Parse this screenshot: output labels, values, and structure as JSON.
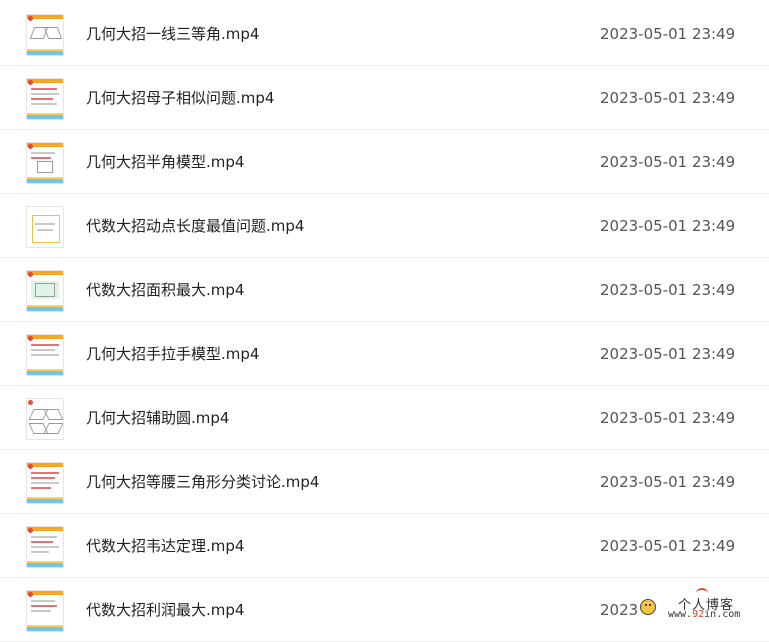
{
  "files": [
    {
      "name": "几何大招一线三等角.mp4",
      "date": "2023-05-01 23:49"
    },
    {
      "name": "几何大招母子相似问题.mp4",
      "date": "2023-05-01 23:49"
    },
    {
      "name": "几何大招半角模型.mp4",
      "date": "2023-05-01 23:49"
    },
    {
      "name": "代数大招动点长度最值问题.mp4",
      "date": "2023-05-01 23:49"
    },
    {
      "name": "代数大招面积最大.mp4",
      "date": "2023-05-01 23:49"
    },
    {
      "name": "几何大招手拉手模型.mp4",
      "date": "2023-05-01 23:49"
    },
    {
      "name": "几何大招辅助圆.mp4",
      "date": "2023-05-01 23:49"
    },
    {
      "name": "几何大招等腰三角形分类讨论.mp4",
      "date": "2023-05-01 23:49"
    },
    {
      "name": "代数大招韦达定理.mp4",
      "date": "2023-05-01 23:49"
    },
    {
      "name": "代数大招利润最大.mp4",
      "date": "2023"
    }
  ],
  "watermark": {
    "title": "个人博客",
    "url_prefix": "www.",
    "url_highlight": "92",
    "url_suffix": "in.com"
  },
  "icons": {
    "thumbnail": "video-thumbnail-icon",
    "watermark": "smiley-icon"
  }
}
